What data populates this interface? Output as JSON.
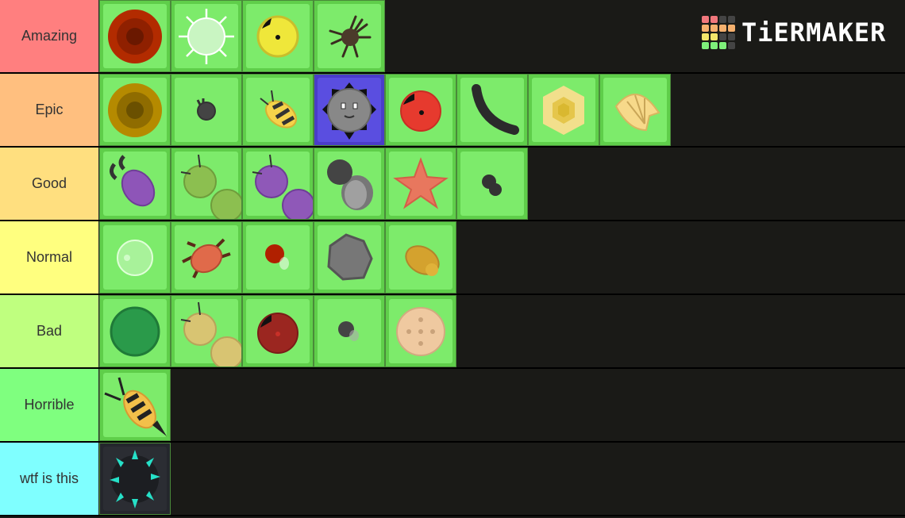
{
  "app": {
    "logo_text": "TiERMAKER"
  },
  "logo_grid_colors": [
    "#f0777c",
    "#f0777c",
    "#444444",
    "#444444",
    "#f5b06e",
    "#f5b06e",
    "#f5b06e",
    "#f5b06e",
    "#f2e66a",
    "#f2e66a",
    "#444444",
    "#444444",
    "#7ef07a",
    "#7ef07a",
    "#7ef07a",
    "#444444"
  ],
  "tiers": [
    {
      "label": "Amazing",
      "color": "#ff7f7f",
      "items": [
        "dark-red-disc",
        "white-spiky-orb",
        "yellow-ladybug",
        "brown-spider"
      ]
    },
    {
      "label": "Epic",
      "color": "#ffbf7f",
      "items": [
        "golden-disc",
        "small-dark-ant-head",
        "bee",
        "gray-smiley-spiked",
        "red-ladybug",
        "black-leech",
        "honeycomb-hexagon",
        "shell"
      ]
    },
    {
      "label": "Good",
      "color": "#ffdf7f",
      "items": [
        "purple-beetle",
        "green-centipede",
        "purple-centipede",
        "gray-fly",
        "starfish",
        "small-black-ant"
      ]
    },
    {
      "label": "Normal",
      "color": "#ffff7f",
      "items": [
        "bubble",
        "crab",
        "fire-ant",
        "gray-rock",
        "golden-mantis"
      ]
    },
    {
      "label": "Bad",
      "color": "#bfff7f",
      "items": [
        "green-cactus",
        "yellow-centipede",
        "dark-red-ladybug",
        "gray-fly-small",
        "sponge"
      ]
    },
    {
      "label": "Horrible",
      "color": "#7fff7f",
      "items": [
        "hornet"
      ]
    },
    {
      "label": "wtf is this",
      "color": "#7fffff",
      "items": [
        "dark-spiky-star"
      ]
    }
  ]
}
